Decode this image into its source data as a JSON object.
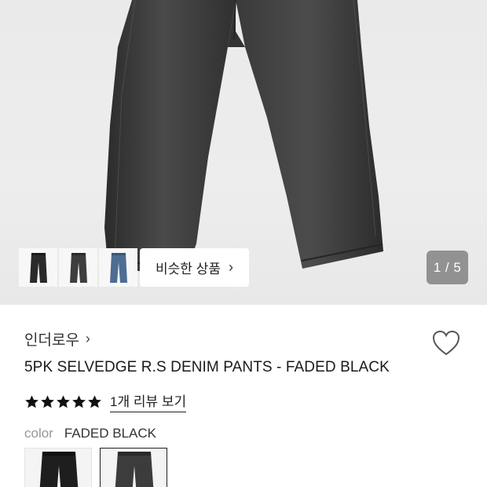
{
  "hero": {
    "similar_label": "비슷한 상품",
    "similar_chevron": "›",
    "page_counter": "1 / 5",
    "thumbnails": [
      {
        "icon": "jeans-thumb-black-icon"
      },
      {
        "icon": "jeans-thumb-faded-black-icon"
      },
      {
        "icon": "jeans-thumb-blue-icon"
      }
    ]
  },
  "product": {
    "brand": "인더로우",
    "brand_chevron": "›",
    "title": "5PK SELVEDGE R.S DENIM PANTS - FADED BLACK",
    "rating_stars": 5,
    "review_link": "1개 리뷰 보기",
    "color_label": "color",
    "color_value": "FADED BLACK"
  },
  "colors": {
    "image_bg": "#ebebeb",
    "denim_faded_black": "#3a3a3a",
    "denim_blue": "#4d6d93",
    "star": "#111111",
    "counter_bg": "#7a7a7a"
  }
}
